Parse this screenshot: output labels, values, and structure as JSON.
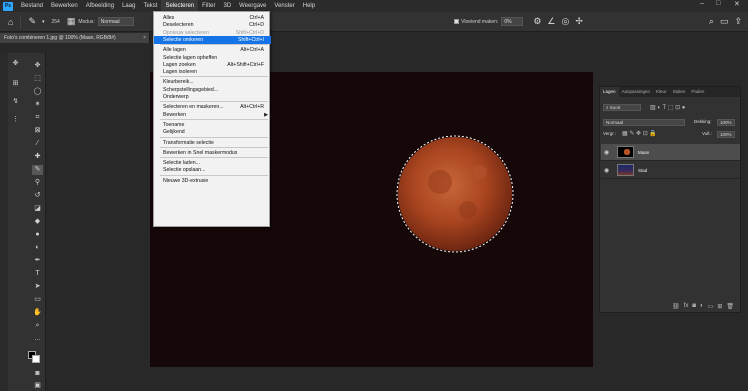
{
  "menubar": {
    "logo": "Ps",
    "items": [
      "Bestand",
      "Bewerken",
      "Afbeelding",
      "Laag",
      "Tekst",
      "Selecteren",
      "Filter",
      "3D",
      "Weergave",
      "Venster",
      "Help"
    ],
    "active_index": 5,
    "minimize": "–",
    "maximize": "□",
    "close": "✕"
  },
  "options": {
    "size": "254",
    "modus_label": "Modus:",
    "modus_value": "Normaal",
    "vloeiend_label": "Vloeiend maken:",
    "vloeiend_value": "0%"
  },
  "document": {
    "tab_title": "Foto's combineren 1.jpg @ 100% (Maan, RGB/8#)",
    "close": "×"
  },
  "select_menu": [
    {
      "label": "Alles",
      "shortcut": "Ctrl+A"
    },
    {
      "label": "Deselecteren",
      "shortcut": "Ctrl+D"
    },
    {
      "label": "Opnieuw selecteren",
      "shortcut": "Shift+Ctrl+D",
      "disabled": true
    },
    {
      "label": "Selectie omkeren",
      "shortcut": "Shift+Ctrl+I",
      "highlight": true
    },
    {
      "sep": true
    },
    {
      "label": "Alle lagen",
      "shortcut": "Alt+Ctrl+A"
    },
    {
      "label": "Selectie lagen opheffen",
      "shortcut": ""
    },
    {
      "label": "Lagen zoeken",
      "shortcut": "Alt+Shift+Ctrl+F"
    },
    {
      "label": "Lagen isoleren",
      "shortcut": ""
    },
    {
      "sep": true
    },
    {
      "label": "Kleurbereik...",
      "shortcut": ""
    },
    {
      "label": "Scherpstellingsgebied...",
      "shortcut": ""
    },
    {
      "label": "Onderwerp",
      "shortcut": ""
    },
    {
      "sep": true
    },
    {
      "label": "Selecteren en maskeren...",
      "shortcut": "Alt+Ctrl+R"
    },
    {
      "label": "Bewerken",
      "shortcut": "",
      "submenu": true
    },
    {
      "sep": true
    },
    {
      "label": "Toename",
      "shortcut": ""
    },
    {
      "label": "Gelijkend",
      "shortcut": ""
    },
    {
      "sep": true
    },
    {
      "label": "Transformatie selectie",
      "shortcut": ""
    },
    {
      "sep": true
    },
    {
      "label": "Bewerken in Snel maskermodus",
      "shortcut": ""
    },
    {
      "sep": true
    },
    {
      "label": "Selectie laden...",
      "shortcut": ""
    },
    {
      "label": "Selectie opslaan...",
      "shortcut": ""
    },
    {
      "sep": true
    },
    {
      "label": "Nieuwe 3D-extrusie",
      "shortcut": ""
    }
  ],
  "layers_panel": {
    "tabs": [
      "Lagen",
      "Aanpassingen",
      "Kleur",
      "Stalen",
      "Paden"
    ],
    "kind_filter": "Soort",
    "blend_mode": "Normaal",
    "opacity_label": "Dekking:",
    "opacity_value": "100%",
    "lock_label": "Vergr.:",
    "fill_label": "Vull.:",
    "fill_value": "100%",
    "layers": [
      {
        "name": "Maan",
        "selected": true
      },
      {
        "name": "Stad",
        "selected": false
      }
    ]
  },
  "colors": {
    "accent": "#1473e6",
    "moon": "#b5522a",
    "canvas": "#160808"
  }
}
